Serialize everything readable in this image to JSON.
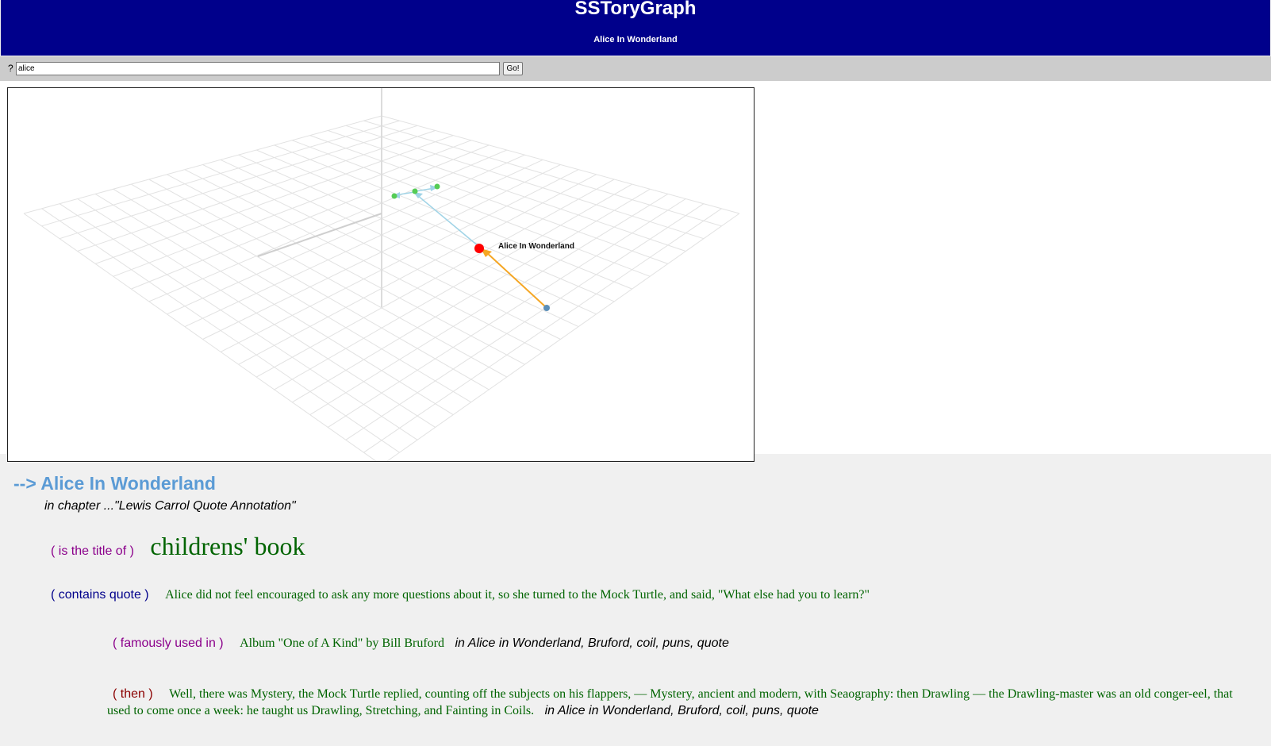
{
  "header": {
    "app_title": "SSToryGraph",
    "subtitle": "Alice In Wonderland",
    "background": "#00008b"
  },
  "search": {
    "prompt": "?",
    "value": "alice",
    "button_label": "Go!"
  },
  "graph": {
    "center_node_label": "Alice In Wonderland",
    "center_node_color": "#ff0000",
    "child_node_color": "#55cc55",
    "parent_node_color": "#5b8fb9",
    "incoming_edge_color": "#f5a623",
    "outgoing_edge_color": "#9fd3e6"
  },
  "result": {
    "node_title": "--> Alice In Wonderland",
    "node_title_color": "#5b9bd5",
    "chapter": "in chapter ...\"Lewis Carrol Quote Annotation\"",
    "relations": [
      {
        "relation": "( is the title of )",
        "value": "childrens' book",
        "tags": ""
      },
      {
        "relation": "( contains quote )",
        "value": "Alice did not feel encouraged to ask any more questions about it, so she turned to the Mock Turtle, and said, \"What else had you to learn?\"",
        "tags": ""
      },
      {
        "relation": "( famously used in )",
        "value": "Album \"One of A Kind\" by Bill Bruford",
        "tags": "in Alice in Wonderland, Bruford, coil, puns, quote"
      },
      {
        "relation": "( then )",
        "value": "Well, there was Mystery, the Mock Turtle replied, counting off the subjects on his flappers, — Mystery, ancient and modern, with Seaography: then Drawling — the Drawling-master was an old conger-eel, that used to come once a week: he taught us Drawling, Stretching, and Fainting in Coils.",
        "tags": "in Alice in Wonderland, Bruford, coil, puns, quote"
      }
    ]
  }
}
